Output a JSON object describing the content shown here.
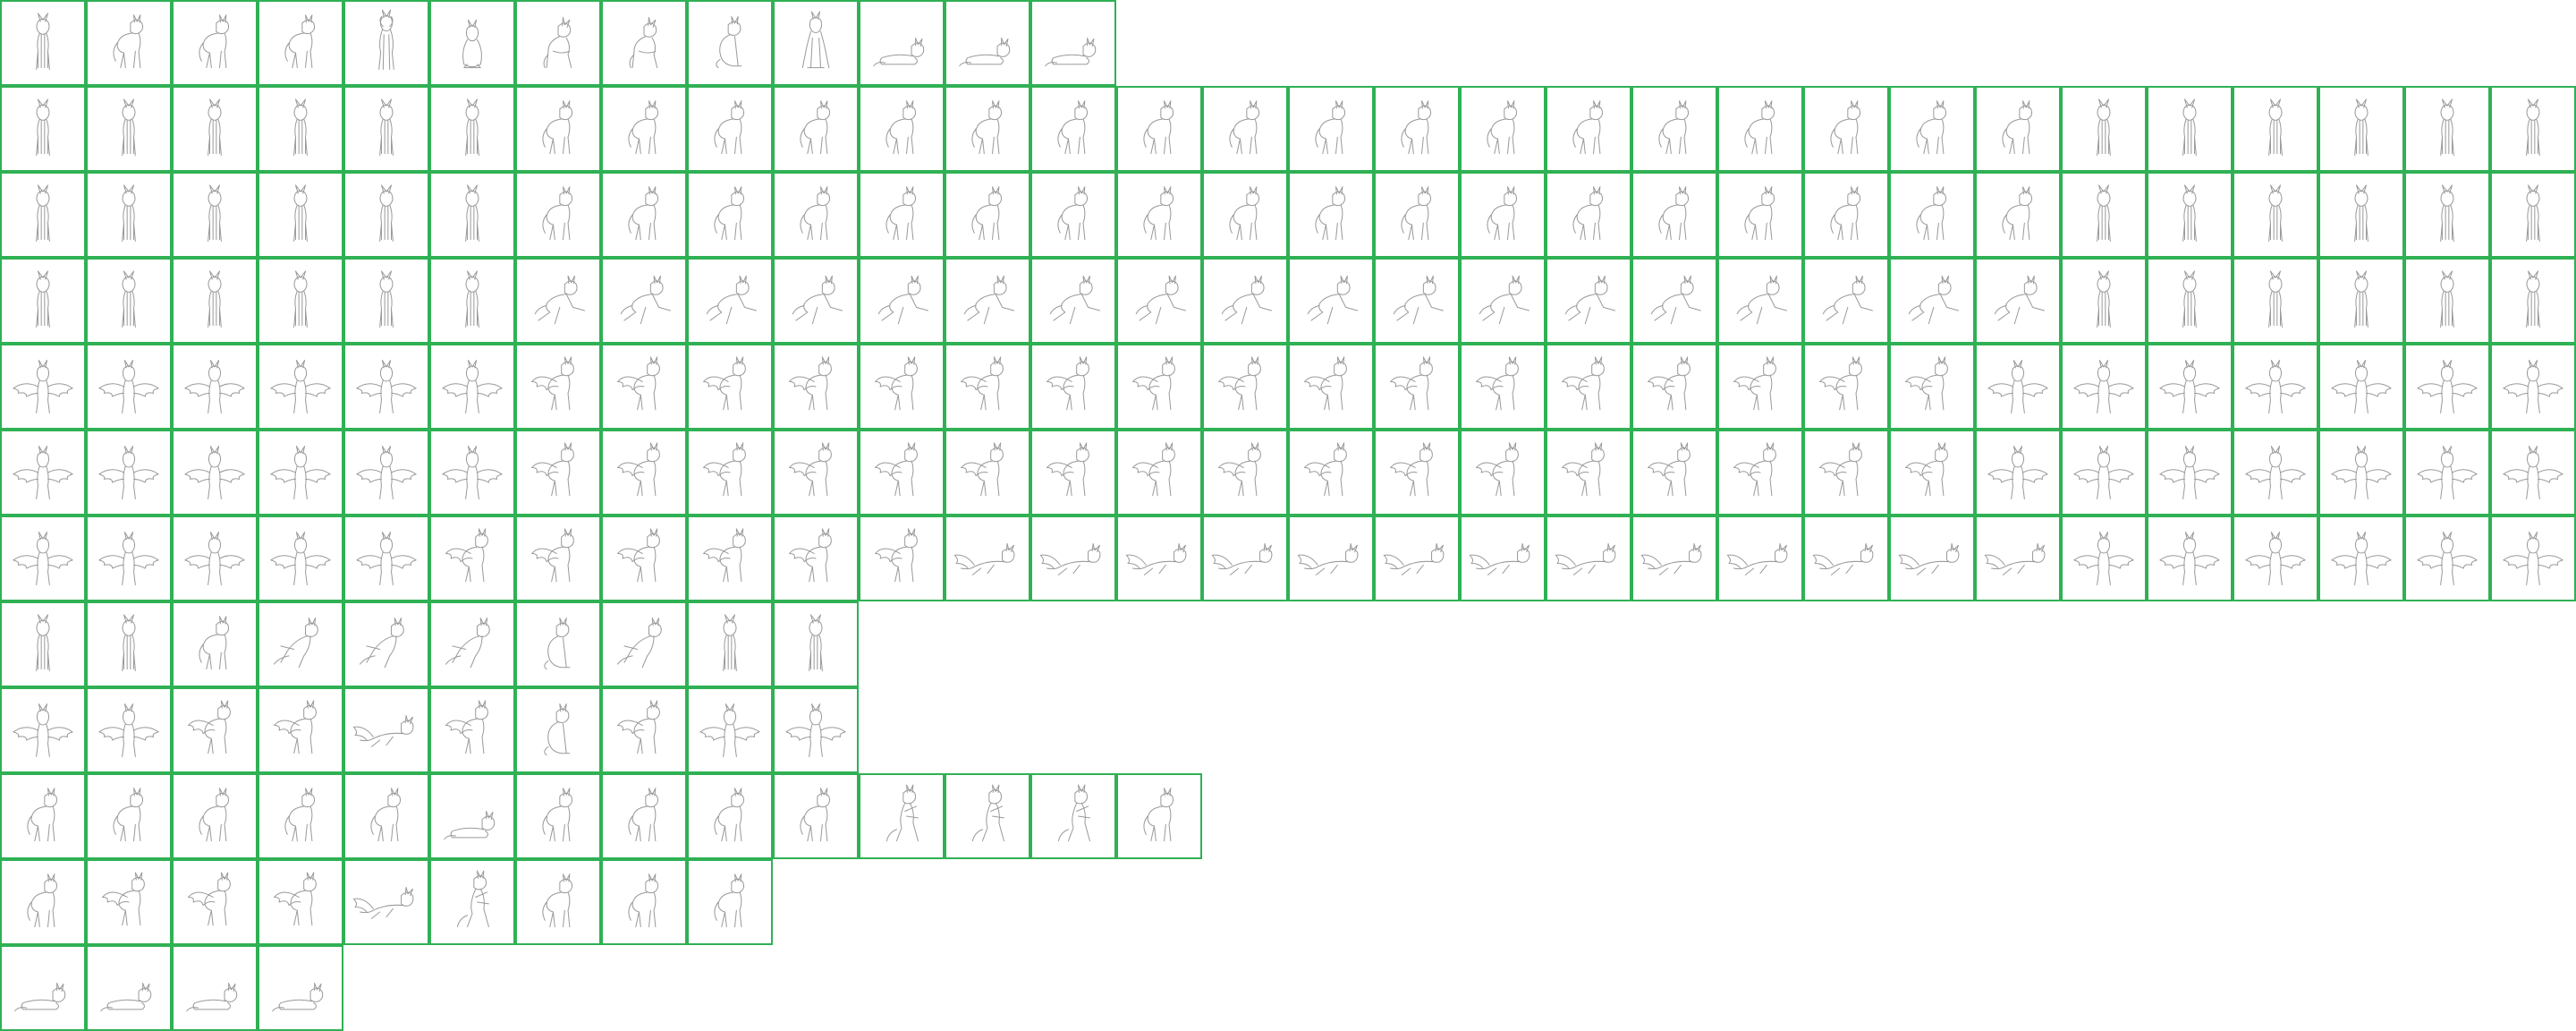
{
  "sheet": {
    "background": "#ffffff",
    "grid_color": "#2fb154",
    "line_color": "#9a9a9a",
    "rows": [
      {
        "label": "row-1",
        "count": 13,
        "poses": [
          "front",
          "walk",
          "walk",
          "walk",
          "front-up",
          "sit",
          "side-tilt",
          "side-tilt",
          "sit-side",
          "front-legs",
          "lie",
          "lie",
          "lie"
        ]
      },
      {
        "label": "row-2",
        "count": 30,
        "poses": [
          "front",
          "front",
          "front",
          "front",
          "front",
          "front",
          "walk",
          "walk",
          "walk",
          "walk",
          "walk",
          "walk",
          "walk",
          "walk",
          "walk",
          "walk",
          "walk",
          "walk",
          "walk",
          "walk",
          "walk",
          "walk",
          "walk",
          "walk",
          "front",
          "front",
          "front",
          "front",
          "front",
          "front"
        ]
      },
      {
        "label": "row-3",
        "count": 30,
        "poses": [
          "front",
          "front",
          "front",
          "front",
          "front",
          "front",
          "walk",
          "walk",
          "walk",
          "walk",
          "walk",
          "walk",
          "walk",
          "walk",
          "walk",
          "walk",
          "walk",
          "walk",
          "walk",
          "walk",
          "walk",
          "walk",
          "walk",
          "walk",
          "front",
          "front",
          "front",
          "front",
          "front",
          "front"
        ]
      },
      {
        "label": "row-4",
        "count": 30,
        "poses": [
          "front",
          "front",
          "front",
          "front",
          "front",
          "front",
          "run",
          "run",
          "run",
          "run",
          "run",
          "run",
          "run",
          "run",
          "run",
          "run",
          "run",
          "run",
          "run",
          "run",
          "run",
          "run",
          "run",
          "run",
          "front",
          "front",
          "front",
          "front",
          "front",
          "front"
        ]
      },
      {
        "label": "row-5",
        "count": 30,
        "poses": [
          "wings",
          "wings",
          "wings",
          "wings",
          "wings",
          "wings",
          "wing-side",
          "wing-side",
          "wing-side",
          "wing-side",
          "wing-side",
          "wing-side",
          "wing-side",
          "wing-side",
          "wing-side",
          "wing-side",
          "wing-side",
          "wing-side",
          "wing-side",
          "wing-side",
          "wing-side",
          "wing-side",
          "wing-side",
          "wings",
          "wings",
          "wings",
          "wings",
          "wings",
          "wings",
          "wings"
        ]
      },
      {
        "label": "row-6",
        "count": 30,
        "poses": [
          "wings",
          "wings",
          "wings",
          "wings",
          "wings",
          "wings",
          "wing-side",
          "wing-side",
          "wing-side",
          "wing-side",
          "wing-side",
          "wing-side",
          "wing-side",
          "wing-side",
          "wing-side",
          "wing-side",
          "wing-side",
          "wing-side",
          "wing-side",
          "wing-side",
          "wing-side",
          "wing-side",
          "wing-side",
          "wings",
          "wings",
          "wings",
          "wings",
          "wings",
          "wings",
          "wings"
        ]
      },
      {
        "label": "row-7",
        "count": 30,
        "poses": [
          "wings",
          "wings",
          "wings",
          "wings",
          "wings",
          "wing-side",
          "wing-side",
          "wing-side",
          "wing-side",
          "wing-side",
          "wing-side",
          "fly",
          "fly",
          "fly",
          "fly",
          "fly",
          "fly",
          "fly",
          "fly",
          "fly",
          "fly",
          "fly",
          "fly",
          "fly",
          "wings",
          "wings",
          "wings",
          "wings",
          "wings",
          "wings"
        ]
      },
      {
        "label": "row-8",
        "count": 10,
        "poses": [
          "front",
          "front",
          "walk",
          "jump",
          "jump",
          "jump",
          "sit-side",
          "jump",
          "front",
          "front"
        ]
      },
      {
        "label": "row-9",
        "count": 10,
        "poses": [
          "wings",
          "wings",
          "wing-side",
          "wing-side",
          "fly",
          "wing-side",
          "sit-side",
          "wing-side",
          "wings",
          "wings"
        ]
      },
      {
        "label": "row-10",
        "count": 14,
        "poses": [
          "walk",
          "walk",
          "walk",
          "walk",
          "walk",
          "lie",
          "walk",
          "walk",
          "walk",
          "walk",
          "rear",
          "rear",
          "rear",
          "walk"
        ]
      },
      {
        "label": "row-11",
        "count": 9,
        "poses": [
          "walk",
          "wing-side",
          "wing-side",
          "wing-side",
          "fly",
          "rear",
          "walk",
          "walk",
          "walk"
        ]
      },
      {
        "label": "row-12",
        "count": 4,
        "poses": [
          "lie",
          "lie",
          "lie",
          "lie"
        ]
      }
    ]
  }
}
